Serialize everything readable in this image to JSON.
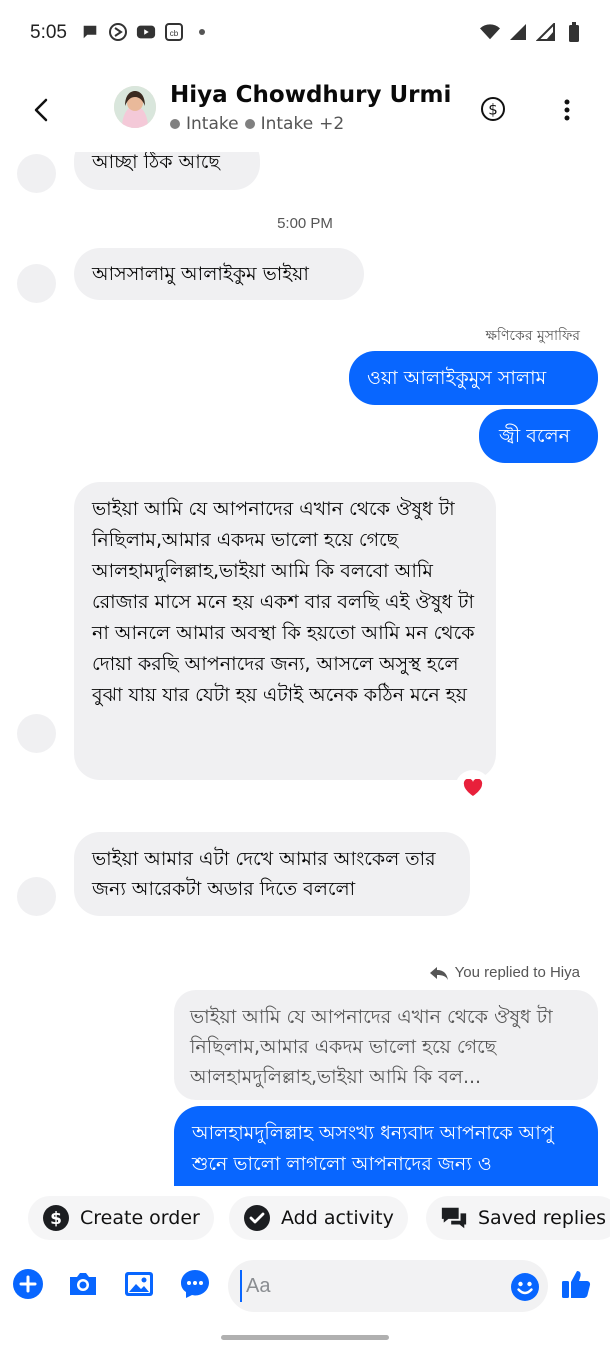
{
  "status_bar": {
    "time": "5:05",
    "notification_icons": [
      "chat-bubble-icon",
      "circle-slash-icon",
      "youtube-icon",
      "cb-app-icon",
      "dot-icon"
    ],
    "system_icons": [
      "wifi-icon",
      "signal-icon",
      "signal-icon",
      "battery-icon"
    ]
  },
  "header": {
    "contact_name": "Hiya Chowdhury Urmi",
    "labels": [
      "Intake",
      "Intake"
    ],
    "extra_labels": "+2"
  },
  "messages": {
    "m1": "আচ্ছা ঠিক আছে",
    "timestamp": "5:00 PM",
    "m2": "আসসালামু আলাইকুম ভাইয়া",
    "sender_label": "ক্ষণিকের মুসাফির",
    "m3": "ওয়া আলাইকুমুস সালাম",
    "m4": "জ্বী বলেন",
    "m5": "ভাইয়া আমি যে আপনাদের এখান থেকে ঔষুধ টা নিছিলাম,আমার একদম ভালো হয়ে গেছে আলহামদুলিল্লাহ,ভাইয়া আমি কি বলবো আমি রোজার মাসে মনে হয় একশ বার বলছি এই ঔষুধ টা না আনলে আমার অবস্থা কি হয়তো আমি মন থেকে দোয়া করছি আপনাদের জন্য, আসলে অসুস্থ হলে বুঝা যায় যার যেটা হয় এটাই অনেক কঠিন মনে হয়",
    "m5_reaction": "❤️",
    "m6": "ভাইয়া আমার এটা দেখে আমার আংকেল তার জন্য আরেকটা অডার দিতে বললো",
    "reply_note": "You replied to Hiya",
    "quoted": "ভাইয়া আমি যে আপনাদের এখান থেকে ঔষুধ টা নিছিলাম,আমার একদম ভালো হয়ে গেছে আলহামদুলিল্লাহ,ভাইয়া আমি কি বল...",
    "m7": "আলহামদুলিল্লাহ অসংখ্য ধন্যবাদ আপনাকে আপু শুনে ভালো লাগলো আপনাদের জন্য ও"
  },
  "quick_actions": {
    "create_order": "Create order",
    "add_activity": "Add activity",
    "saved_replies": "Saved replies"
  },
  "composer": {
    "placeholder": "Aa"
  },
  "colors": {
    "accent": "#0866ff",
    "incoming_bubble": "#f0f0f2"
  }
}
